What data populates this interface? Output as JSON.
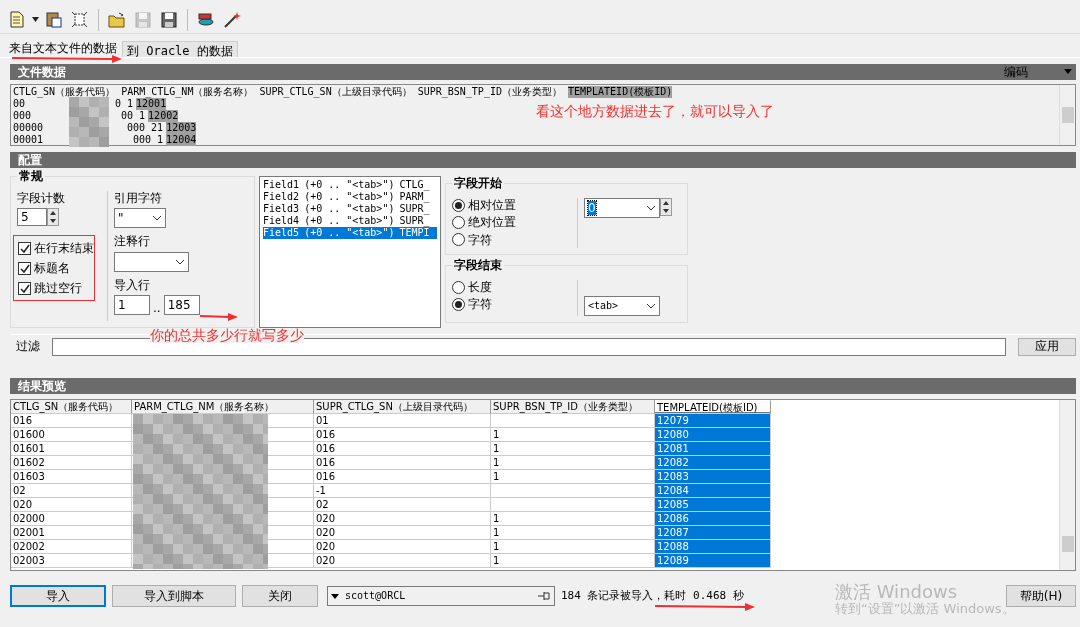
{
  "toolbar": [
    {
      "kind": "new",
      "disabled": false
    },
    {
      "kind": "paste",
      "disabled": false
    },
    {
      "kind": "clear",
      "disabled": false
    },
    {
      "kind": "open",
      "disabled": false
    },
    {
      "kind": "save",
      "disabled": true
    },
    {
      "kind": "saveas",
      "disabled": false
    },
    {
      "kind": "database",
      "disabled": false
    },
    {
      "kind": "wizard",
      "disabled": false
    }
  ],
  "tabs": [
    {
      "label": "来自文本文件的数据",
      "selected": true
    },
    {
      "label": "到 Oracle 的数据",
      "selected": false
    }
  ],
  "file_data": {
    "title": "文件数据",
    "encoding_label": "编码",
    "header": [
      {
        "text": "CTLG_SN（服务代码）",
        "selected": false
      },
      {
        "text": "PARM_CTLG_NM（服务名称）",
        "selected": false
      },
      {
        "text": "SUPR_CTLG_SN（上级目录代码）",
        "selected": false
      },
      {
        "text": "SUPR_BSN_TP_ID（业务类型）",
        "selected": false
      },
      {
        "text": "TEMPLATEID(模板ID)",
        "selected": true
      }
    ],
    "lines": [
      {
        "start": "00",
        "end": "0 1",
        "id": "12001"
      },
      {
        "start": "000",
        "end": "00 1",
        "id": "12002"
      },
      {
        "start": "00000",
        "end": "000 21",
        "id": "12003"
      },
      {
        "start": "00001",
        "end": "000 1",
        "id": "12004"
      }
    ],
    "note": "看这个地方数据进去了，就可以导入了"
  },
  "config": {
    "title": "配置",
    "general": {
      "title": "常规",
      "field_count_label": "字段计数",
      "field_count": "5",
      "checkboxes": [
        {
          "label": "在行末结束",
          "checked": true
        },
        {
          "label": "标题名",
          "checked": true
        },
        {
          "label": "跳过空行",
          "checked": true
        }
      ],
      "quote_label": "引用字符",
      "quote_value": "\"",
      "comment_label": "注释行",
      "import_rows_label": "导入行",
      "row_from": "1",
      "row_separator": "..",
      "row_to": "185"
    },
    "fields": [
      {
        "name": "Field1",
        "spec": "(+0 .. \"<tab>\")",
        "column": "CTLG_",
        "selected": false
      },
      {
        "name": "Field2",
        "spec": "(+0 .. \"<tab>\")",
        "column": "PARM_",
        "selected": false
      },
      {
        "name": "Field3",
        "spec": "(+0 .. \"<tab>\")",
        "column": "SUPR_",
        "selected": false
      },
      {
        "name": "Field4",
        "spec": "(+0 .. \"<tab>\")",
        "column": "SUPR_",
        "selected": false
      },
      {
        "name": "Field5",
        "spec": "(+0 .. \"<tab>\")",
        "column": "TEMPI",
        "selected": true
      }
    ],
    "field_start": {
      "title": "字段开始",
      "options": [
        {
          "label": "相对位置",
          "selected": true
        },
        {
          "label": "绝对位置",
          "selected": false
        },
        {
          "label": "字符",
          "selected": false
        }
      ],
      "value": "0"
    },
    "field_end": {
      "title": "字段结束",
      "options": [
        {
          "label": "长度",
          "selected": false
        },
        {
          "label": "字符",
          "selected": true
        }
      ],
      "value": "<tab>"
    },
    "note": "你的总共多少行就写多少"
  },
  "filter": {
    "label": "过滤",
    "button": "应用"
  },
  "preview": {
    "title": "结果预览",
    "columns": [
      {
        "text": "CTLG_SN（服务代码）",
        "selected": false
      },
      {
        "text": "PARM_CTLG_NM（服务名称）",
        "selected": false
      },
      {
        "text": "SUPR_CTLG_SN（上级目录代码）",
        "selected": false
      },
      {
        "text": "SUPR_BSN_TP_ID（业务类型）",
        "selected": false
      },
      {
        "text": "TEMPLATEID(模板ID)",
        "selected": true
      }
    ],
    "rows": [
      {
        "ctlg_sn": "016",
        "supr_ctlg_sn": "01",
        "templateid": "12079"
      },
      {
        "ctlg_sn": "01600",
        "supr_ctlg_sn": "016",
        "supr_bsn_tp_id": "1",
        "templateid": "12080"
      },
      {
        "ctlg_sn": "01601",
        "supr_ctlg_sn": "016",
        "supr_bsn_tp_id": "1",
        "templateid": "12081"
      },
      {
        "ctlg_sn": "01602",
        "supr_ctlg_sn": "016",
        "supr_bsn_tp_id": "1",
        "templateid": "12082"
      },
      {
        "ctlg_sn": "01603",
        "supr_ctlg_sn": "016",
        "supr_bsn_tp_id": "1",
        "templateid": "12083"
      },
      {
        "ctlg_sn": "02",
        "supr_ctlg_sn": "-1",
        "templateid": "12084"
      },
      {
        "ctlg_sn": "020",
        "supr_ctlg_sn": "02",
        "templateid": "12085"
      },
      {
        "ctlg_sn": "02000",
        "supr_ctlg_sn": "020",
        "supr_bsn_tp_id": "1",
        "templateid": "12086"
      },
      {
        "ctlg_sn": "02001",
        "supr_ctlg_sn": "020",
        "supr_bsn_tp_id": "1",
        "templateid": "12087"
      },
      {
        "ctlg_sn": "02002",
        "supr_ctlg_sn": "020",
        "supr_bsn_tp_id": "1",
        "templateid": "12088"
      },
      {
        "ctlg_sn": "02003",
        "supr_ctlg_sn": "020",
        "supr_bsn_tp_id": "1",
        "templateid": "12089"
      }
    ]
  },
  "bottom": {
    "buttons": [
      {
        "label": "导入",
        "default": true
      },
      {
        "label": "导入到脚本",
        "default": false
      },
      {
        "label": "关闭",
        "default": false
      }
    ],
    "connection": "scott@ORCL",
    "status": "184 条记录被导入，耗时 0.468 秒",
    "help": "帮助(H)"
  },
  "os_watermark": [
    "激活 Windows",
    "转到“设置”以激活 Windows。"
  ]
}
